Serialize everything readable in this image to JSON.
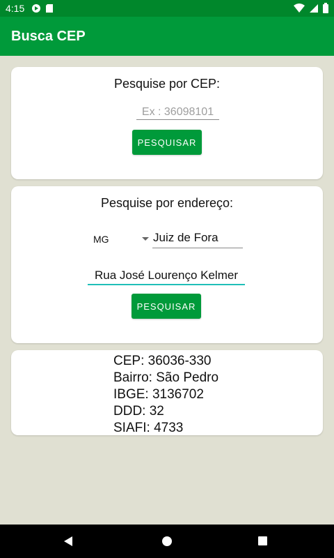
{
  "status_bar": {
    "time": "4:15",
    "icons_left": [
      "play-protect-icon",
      "sd-card-icon"
    ],
    "icons_right": [
      "wifi-icon",
      "signal-icon",
      "battery-icon"
    ]
  },
  "app_bar": {
    "title": "Busca CEP"
  },
  "cep_search": {
    "title": "Pesquise por CEP:",
    "cep_placeholder": "Ex : 36098101",
    "cep_value": "",
    "button_label": "PESQUISAR"
  },
  "address_search": {
    "title": "Pesquise por endereço:",
    "uf_selected": "MG",
    "city_value": "Juiz de Fora",
    "street_value": "Rua José Lourenço Kelmer",
    "button_label": "PESQUISAR"
  },
  "result": {
    "cep": "CEP: 36036-330",
    "bairro": "Bairro: São Pedro",
    "ibge": "IBGE: 3136702",
    "ddd": "DDD: 32",
    "siafi": "SIAFI: 4733"
  },
  "nav_bar": {
    "buttons": [
      "back-icon",
      "home-icon",
      "recents-icon"
    ]
  },
  "colors": {
    "primary": "#009a3a",
    "primary_dark": "#00872b",
    "accent": "#1fbfb8",
    "background": "#e0e0d2"
  }
}
